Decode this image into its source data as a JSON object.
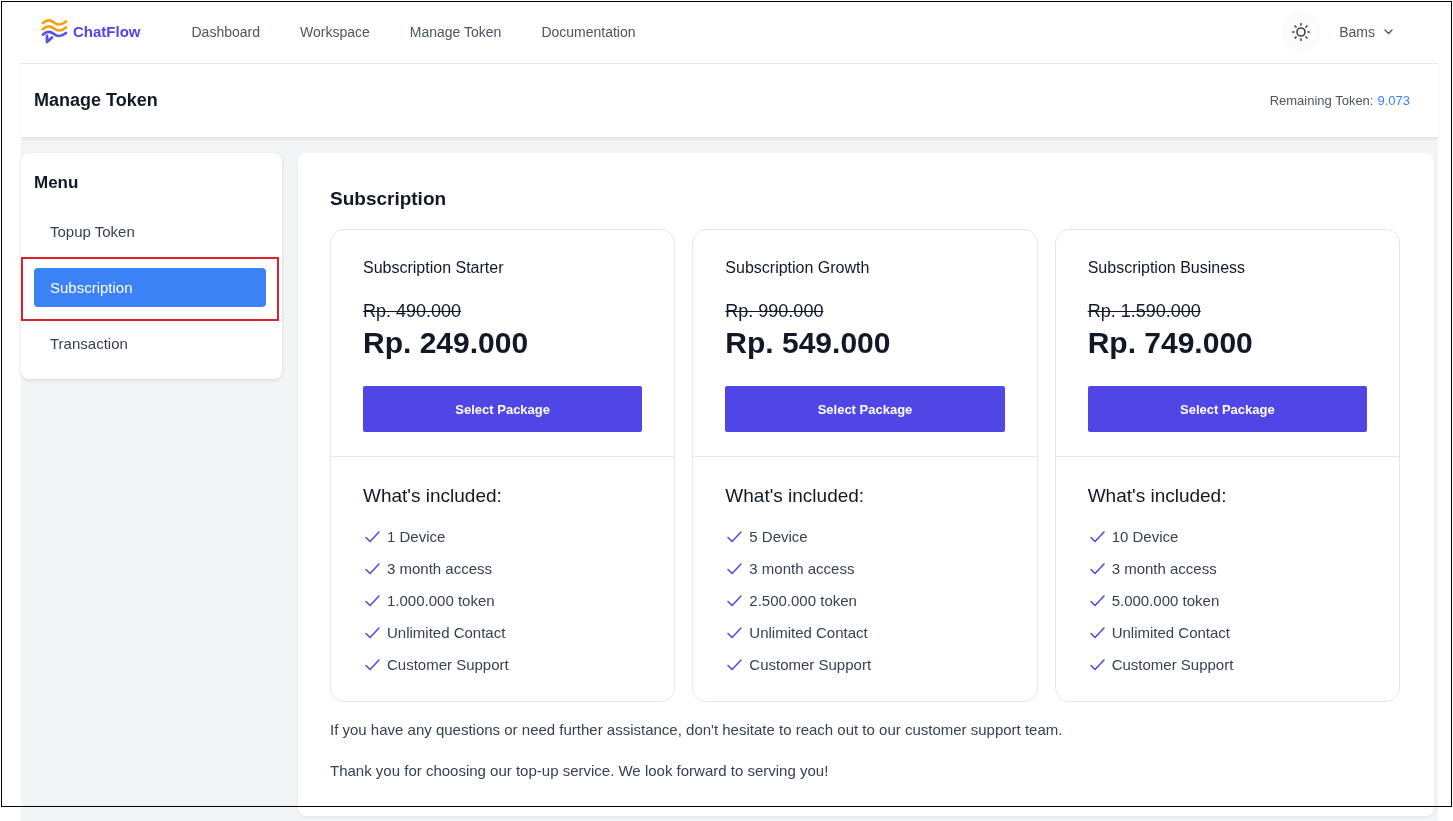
{
  "nav": {
    "logo_text": "ChatFlow",
    "links": [
      "Dashboard",
      "Workspace",
      "Manage Token",
      "Documentation"
    ],
    "user": "Bams"
  },
  "page_header": {
    "title": "Manage Token",
    "remaining_label": "Remaining Token:",
    "remaining_value": "9.073"
  },
  "sidebar": {
    "title": "Menu",
    "items": [
      {
        "label": "Topup Token",
        "selected": false,
        "highlighted": false
      },
      {
        "label": "Subscription",
        "selected": true,
        "highlighted": true
      },
      {
        "label": "Transaction",
        "selected": false,
        "highlighted": false
      }
    ]
  },
  "content": {
    "title": "Subscription",
    "plans": [
      {
        "name": "Subscription Starter",
        "old_price": "Rp. 490.000",
        "price": "Rp. 249.000",
        "button": "Select Package",
        "features_title": "What's included:",
        "features": [
          "1 Device",
          "3 month access",
          "1.000.000 token",
          "Unlimited Contact",
          "Customer Support"
        ]
      },
      {
        "name": "Subscription Growth",
        "old_price": "Rp. 990.000",
        "price": "Rp. 549.000",
        "button": "Select Package",
        "features_title": "What's included:",
        "features": [
          "5 Device",
          "3 month access",
          "2.500.000 token",
          "Unlimited Contact",
          "Customer Support"
        ]
      },
      {
        "name": "Subscription Business",
        "old_price": "Rp. 1.590.000",
        "price": "Rp. 749.000",
        "button": "Select Package",
        "features_title": "What's included:",
        "features": [
          "10 Device",
          "3 month access",
          "5.000.000 token",
          "Unlimited Contact",
          "Customer Support"
        ]
      }
    ],
    "notes": [
      "If you have any questions or need further assistance, don't hesitate to reach out to our customer support team.",
      "Thank you for choosing our top-up service. We look forward to serving you!"
    ]
  }
}
